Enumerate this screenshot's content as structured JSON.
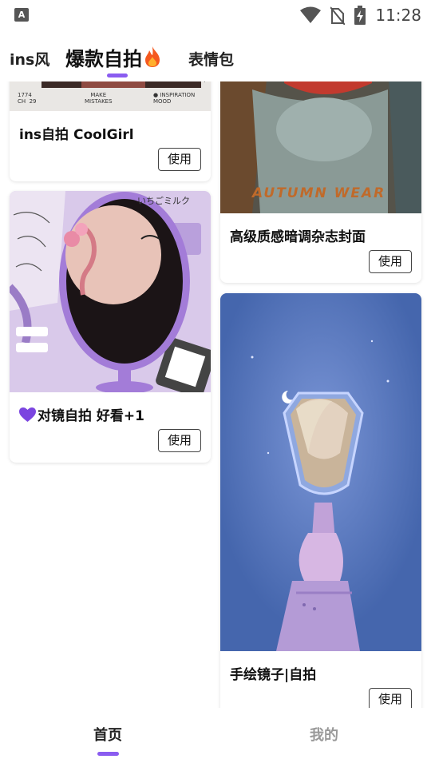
{
  "status_bar": {
    "app_icon_letter": "A",
    "time": "11:28"
  },
  "tabs": [
    {
      "label": "ins风"
    },
    {
      "label": "爆款自拍"
    },
    {
      "label": "表情包"
    }
  ],
  "cards": [
    {
      "title": "ins自拍 CoolGirl",
      "button": "使用",
      "img_caption_left": "1774\nCH  29",
      "img_caption_mid": "MAKE\nMISTAKES",
      "img_caption_right": "● INSPIRATION\nMOOD"
    },
    {
      "title": "高级质感暗调杂志封面",
      "button": "使用",
      "img_text": "AUTUMN WEAR"
    },
    {
      "title": "对镜自拍 好看+1",
      "button": "使用",
      "img_text": "いちごミルク"
    },
    {
      "title": "手绘镜子|自拍",
      "button": "使用"
    }
  ],
  "bottom_nav": {
    "home": "首页",
    "mine": "我的"
  },
  "colors": {
    "accent": "#8a5cf0",
    "heart": "#7b45e0"
  }
}
